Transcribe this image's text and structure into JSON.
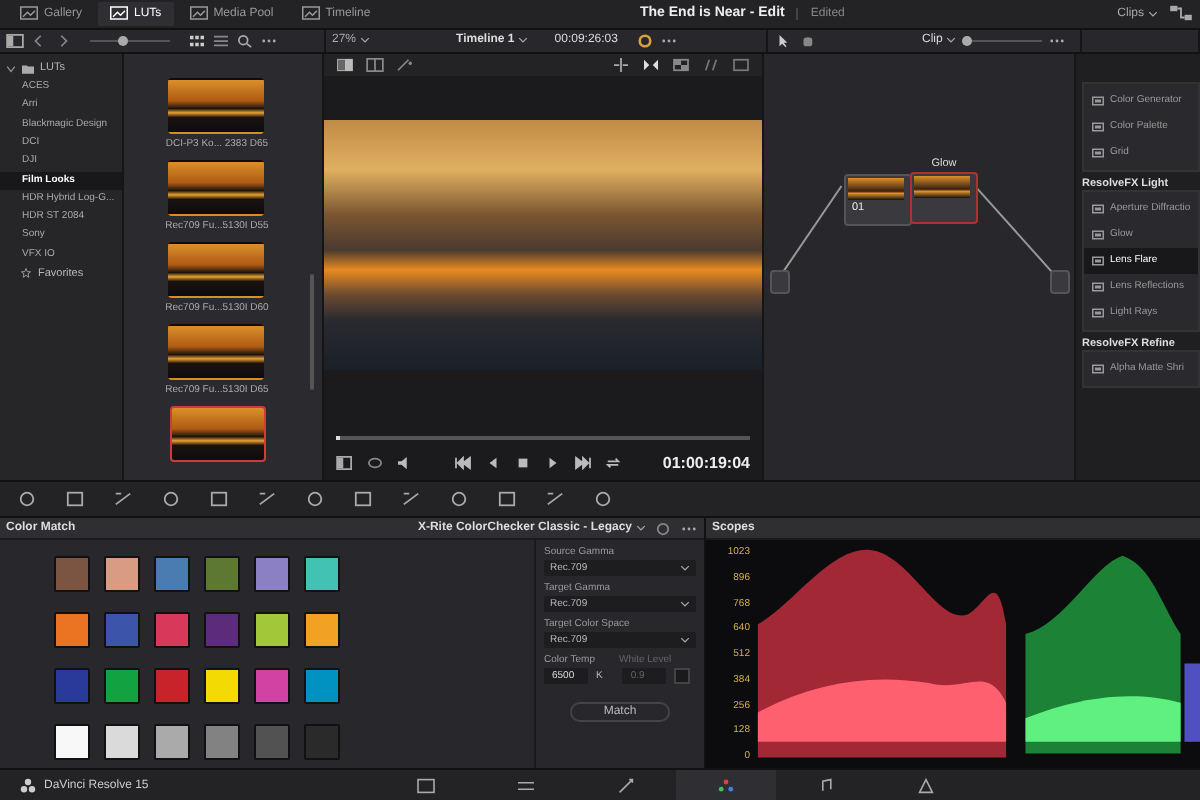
{
  "top_tabs": [
    {
      "label": "Gallery",
      "selected": false
    },
    {
      "label": "LUTs",
      "selected": true
    },
    {
      "label": "Media Pool",
      "selected": false
    },
    {
      "label": "Timeline",
      "selected": false
    }
  ],
  "project": {
    "title": "The End is Near - Edit",
    "status": "Edited"
  },
  "workspace_dropdown": "Clips",
  "thumbnail_size": {
    "level": 0.4
  },
  "lut_tree": {
    "label": "LUTs",
    "expanded": true,
    "children": [
      {
        "label": "ACES",
        "selected": false
      },
      {
        "label": "Arri",
        "selected": false
      },
      {
        "label": "Blackmagic Design",
        "selected": false
      },
      {
        "label": "DCI",
        "selected": false
      },
      {
        "label": "DJI",
        "selected": false
      },
      {
        "label": "Film Looks",
        "selected": true
      },
      {
        "label": "HDR Hybrid Log-G...",
        "selected": false
      },
      {
        "label": "HDR ST 2084",
        "selected": false
      },
      {
        "label": "Sony",
        "selected": false
      },
      {
        "label": "VFX IO",
        "selected": false
      }
    ]
  },
  "favorites": "Favorites",
  "lut_thumbnails": [
    {
      "label": "DCI-P3 Ko... 2383 D65",
      "selected": false
    },
    {
      "label": "Rec709 Fu...5130I D55",
      "selected": false
    },
    {
      "label": "Rec709 Fu...5130I D60",
      "selected": false
    },
    {
      "label": "Rec709 Fu...5130I D65",
      "selected": false
    },
    {
      "selected": true
    }
  ],
  "viewer": {
    "zoom": "27%",
    "timeline": "Timeline 1",
    "timecode": "00:09:26:03",
    "playhead": {
      "level": 0.01
    },
    "current_time": "01:00:19:04"
  },
  "node_editor": {
    "mode": "Clip",
    "zoom": {
      "level": 0
    },
    "nodes": [
      {
        "number": "01",
        "selected": false
      },
      {
        "name": "Glow",
        "selected": true
      }
    ]
  },
  "fx_library": [
    {
      "items": [
        {
          "label": "Color Generator",
          "selected": false
        },
        {
          "label": "Color Palette",
          "selected": false
        },
        {
          "label": "Grid",
          "selected": false
        }
      ]
    },
    {
      "title": "ResolveFX Light",
      "items": [
        {
          "label": "Aperture Diffractio",
          "selected": false
        },
        {
          "label": "Glow",
          "selected": false
        },
        {
          "label": "Lens Flare",
          "selected": true
        },
        {
          "label": "Lens Reflections",
          "selected": false
        },
        {
          "label": "Light Rays",
          "selected": false
        }
      ]
    },
    {
      "title": "ResolveFX Refine",
      "items": [
        {
          "label": "Alpha Matte Shri",
          "selected": false
        }
      ]
    }
  ],
  "color_match": {
    "title": "Color Match",
    "chart": "X-Rite ColorChecker Classic - Legacy",
    "swatches": [
      {
        "color": "#7c5442"
      },
      {
        "color": "#d99c82"
      },
      {
        "color": "#4a7cb2"
      },
      {
        "color": "#5c7832"
      },
      {
        "color": "#8a80c2"
      },
      {
        "color": "#42c2b2"
      },
      {
        "color": "#ea7422"
      },
      {
        "color": "#3c54aa"
      },
      {
        "color": "#d8385a"
      },
      {
        "color": "#5c2c7a"
      },
      {
        "color": "#a2c83a"
      },
      {
        "color": "#f2a222"
      },
      {
        "color": "#2a3a9a"
      },
      {
        "color": "#12a242"
      },
      {
        "color": "#c8222a"
      },
      {
        "color": "#f2da02"
      },
      {
        "color": "#d242a2"
      },
      {
        "color": "#0292c2"
      },
      {
        "color": "#f8f8f8"
      },
      {
        "color": "#dadada"
      },
      {
        "color": "#aaaaaa"
      },
      {
        "color": "#828282"
      },
      {
        "color": "#525252"
      },
      {
        "color": "#2a2a2a"
      }
    ],
    "fields": [
      {
        "label": "Source Gamma",
        "value": "Rec.709"
      },
      {
        "label": "Target Gamma",
        "value": "Rec.709"
      },
      {
        "label": "Target Color Space",
        "value": "Rec.709"
      }
    ],
    "color_temp": {
      "label": "Color Temp",
      "value": "6500",
      "unit": "K"
    },
    "white_level": {
      "label": "White Level",
      "value": "0.9",
      "disabled": true,
      "checked": false
    },
    "match_button": "Match"
  },
  "scopes": {
    "title": "Scopes",
    "scale": [
      "1023",
      "896",
      "768",
      "640",
      "512",
      "384",
      "256",
      "128",
      "0"
    ]
  },
  "status_bar": {
    "app": "DaVinci Resolve 15",
    "pages": [
      {
        "kind": "media",
        "selected": false
      },
      {
        "kind": "edit",
        "selected": false
      },
      {
        "kind": "fusion",
        "selected": false
      },
      {
        "kind": "color",
        "selected": true
      },
      {
        "kind": "fairlight",
        "selected": false
      },
      {
        "kind": "deliver",
        "selected": false
      }
    ]
  }
}
